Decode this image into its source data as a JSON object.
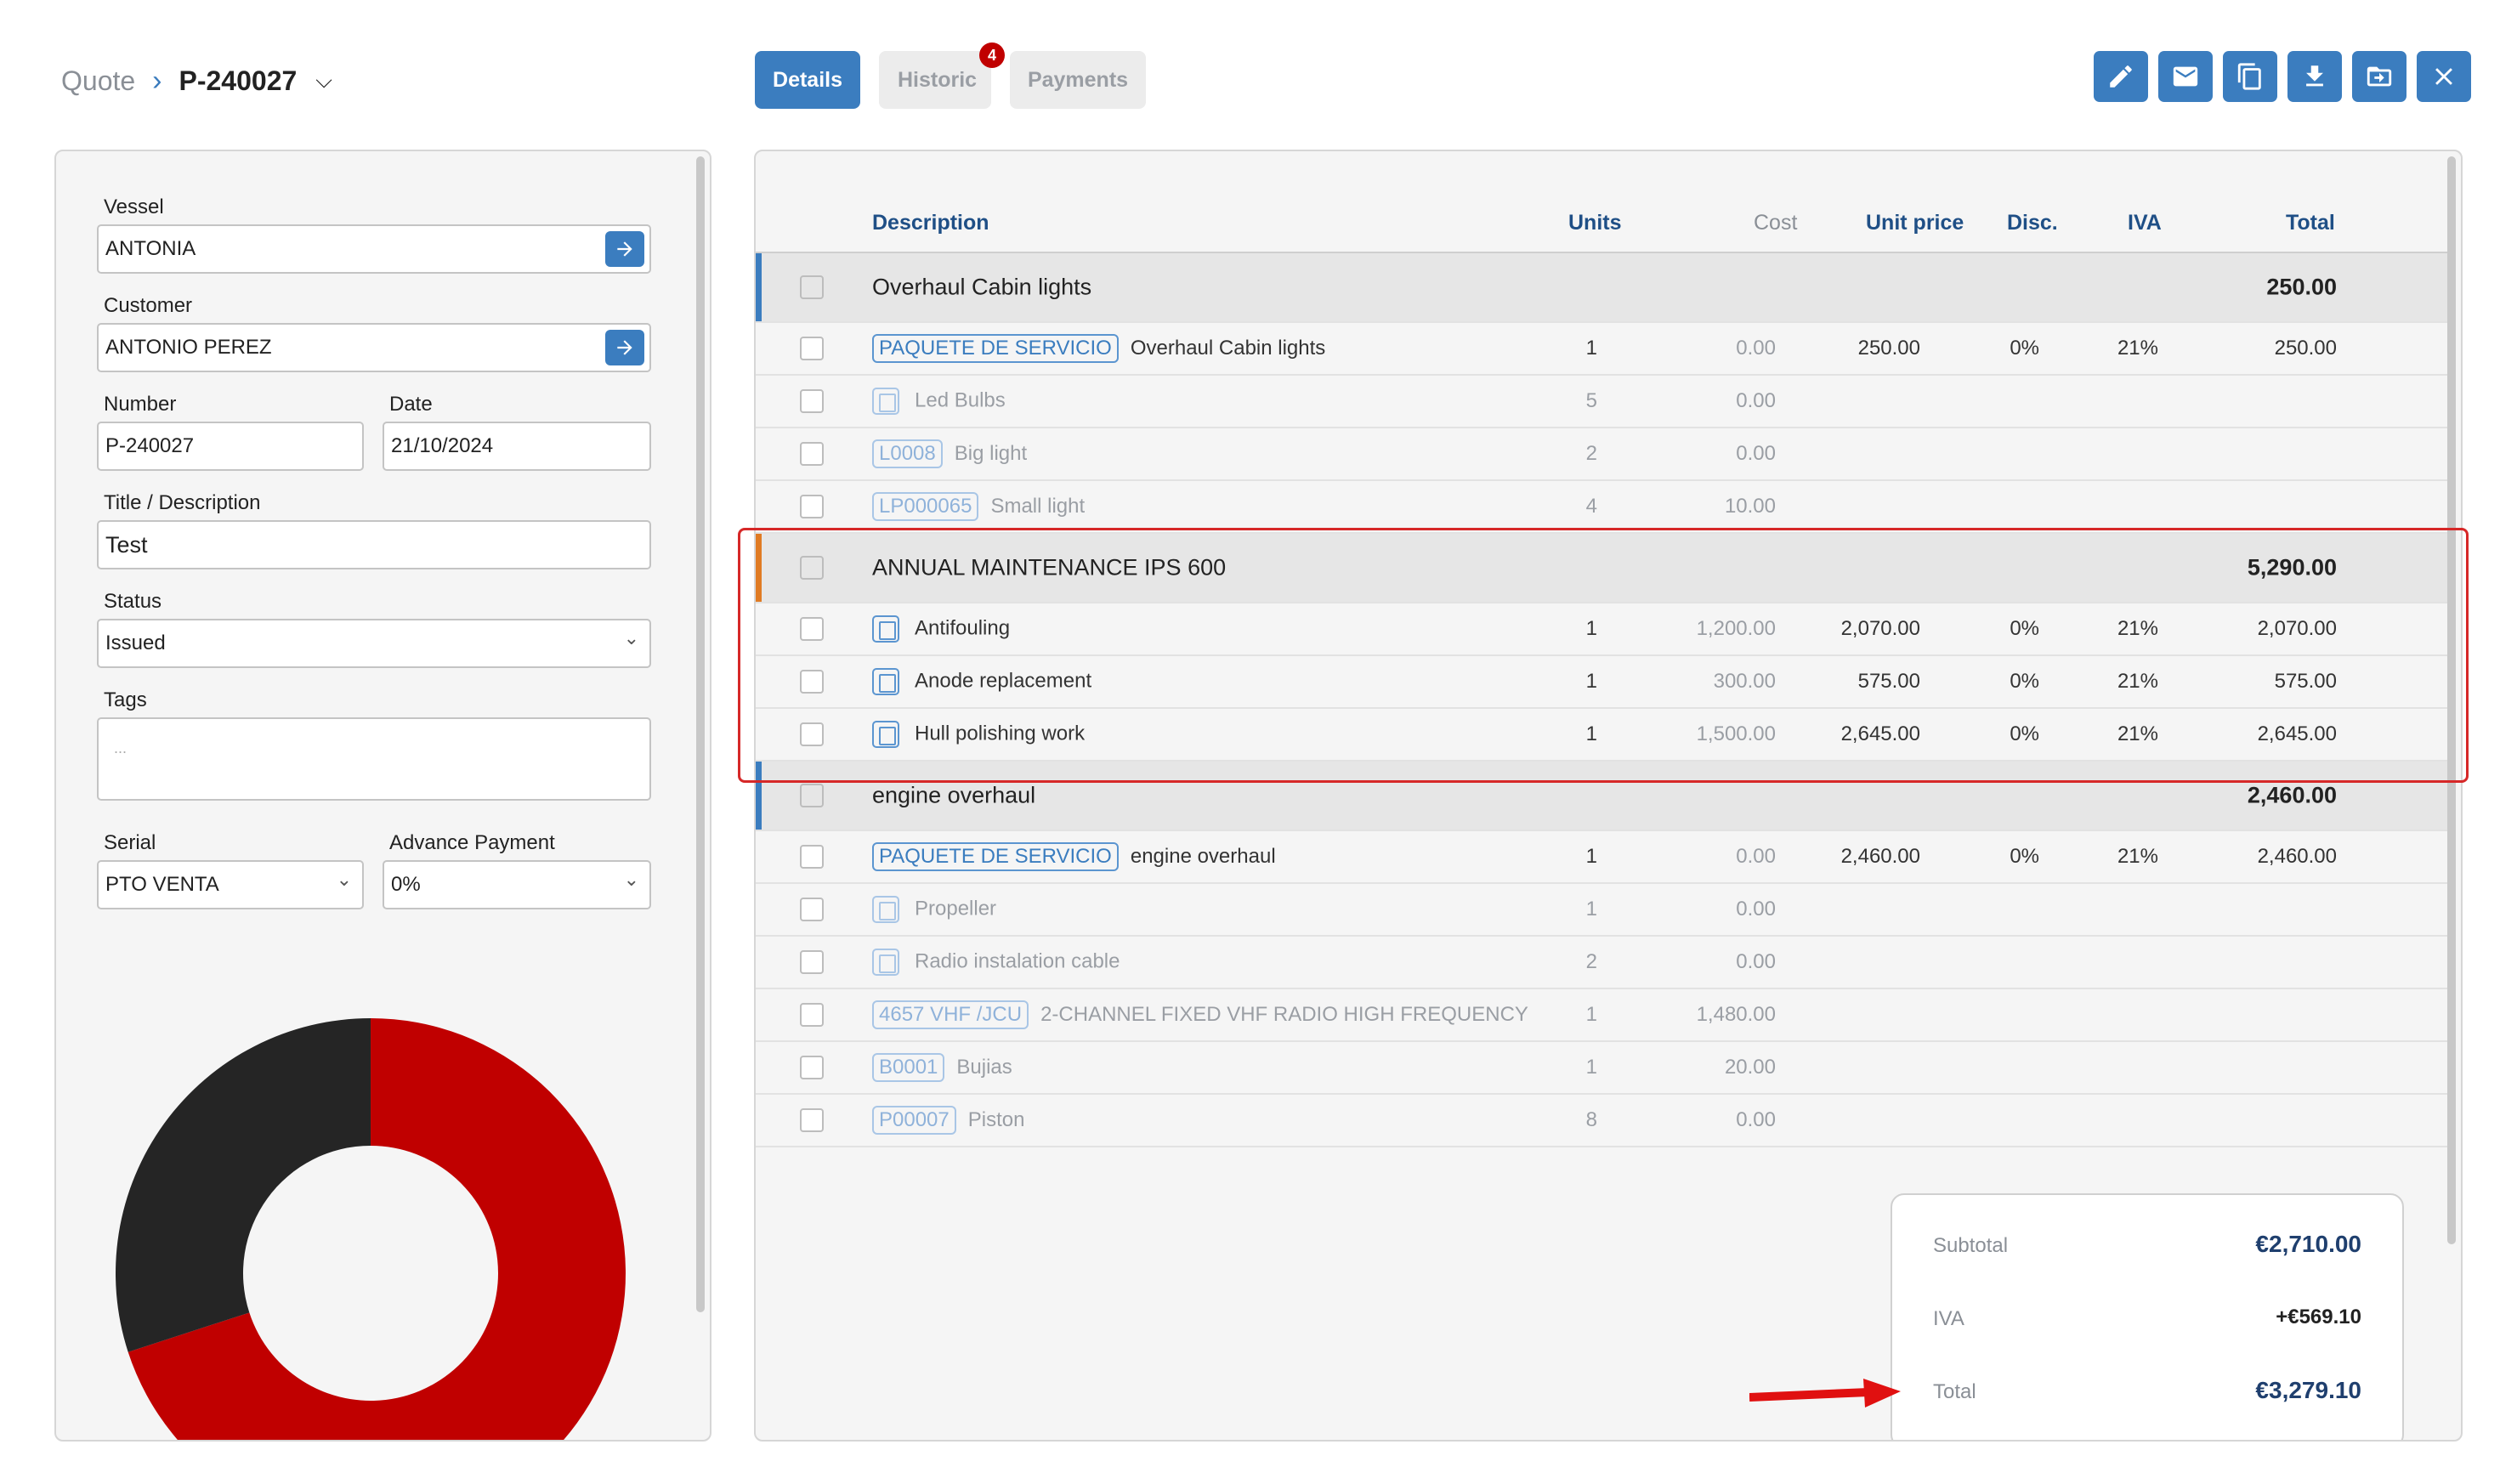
{
  "breadcrumb": {
    "root": "Quote",
    "current": "P-240027"
  },
  "tabs": [
    {
      "label": "Details",
      "active": true
    },
    {
      "label": "Historic",
      "badge": "4"
    },
    {
      "label": "Payments"
    }
  ],
  "toolbar": [
    "edit-icon",
    "mail-icon",
    "copy-icon",
    "download-icon",
    "move-folder-icon",
    "close-icon"
  ],
  "form": {
    "vessel": {
      "label": "Vessel",
      "value": "ANTONIA"
    },
    "customer": {
      "label": "Customer",
      "value": "ANTONIO PEREZ"
    },
    "number": {
      "label": "Number",
      "value": "P-240027"
    },
    "date": {
      "label": "Date",
      "value": "21/10/2024"
    },
    "title": {
      "label": "Title / Description",
      "value": "Test"
    },
    "status": {
      "label": "Status",
      "value": "Issued"
    },
    "tags": {
      "label": "Tags",
      "placeholder": "..."
    },
    "serial": {
      "label": "Serial",
      "value": "PTO VENTA"
    },
    "advance": {
      "label": "Advance Payment",
      "value": "0%"
    }
  },
  "chart_data": {
    "type": "pie",
    "donut": true,
    "slices": [
      {
        "value": 0.7,
        "color": "#c00000"
      },
      {
        "value": 0.3,
        "color": "#252525"
      }
    ]
  },
  "table": {
    "headers": {
      "description": "Description",
      "units": "Units",
      "cost": "Cost",
      "unit_price": "Unit price",
      "disc": "Disc.",
      "iva": "IVA",
      "total": "Total"
    },
    "rows": [
      {
        "kind": "group",
        "bar": "#3b7dbf",
        "desc": "Overhaul Cabin lights",
        "total": "250.00"
      },
      {
        "kind": "item",
        "tag": "PAQUETE DE SERVICIO",
        "desc": "Overhaul Cabin lights",
        "units": "1",
        "cost": "0.00",
        "price": "250.00",
        "disc": "0%",
        "iva": "21%",
        "total": "250.00"
      },
      {
        "kind": "sub",
        "icon": "product-icon",
        "desc": "Led Bulbs",
        "units": "5",
        "cost": "0.00"
      },
      {
        "kind": "sub",
        "tag": "L0008",
        "desc": "Big light",
        "units": "2",
        "cost": "0.00"
      },
      {
        "kind": "sub",
        "tag": "LP000065",
        "desc": "Small light",
        "units": "4",
        "cost": "10.00"
      },
      {
        "kind": "group",
        "bar": "#e07b24",
        "desc": "ANNUAL MAINTENANCE IPS 600",
        "total": "5,290.00"
      },
      {
        "kind": "item",
        "icon": "product-icon",
        "desc": "Antifouling",
        "units": "1",
        "cost": "1,200.00",
        "price": "2,070.00",
        "disc": "0%",
        "iva": "21%",
        "total": "2,070.00"
      },
      {
        "kind": "item",
        "icon": "product-icon",
        "desc": "Anode replacement",
        "units": "1",
        "cost": "300.00",
        "price": "575.00",
        "disc": "0%",
        "iva": "21%",
        "total": "575.00"
      },
      {
        "kind": "item",
        "icon": "product-icon",
        "desc": "Hull polishing work",
        "units": "1",
        "cost": "1,500.00",
        "price": "2,645.00",
        "disc": "0%",
        "iva": "21%",
        "total": "2,645.00"
      },
      {
        "kind": "group",
        "bar": "#3b7dbf",
        "desc": "engine overhaul",
        "total": "2,460.00"
      },
      {
        "kind": "item",
        "tag": "PAQUETE DE SERVICIO",
        "desc": "engine overhaul",
        "units": "1",
        "cost": "0.00",
        "price": "2,460.00",
        "disc": "0%",
        "iva": "21%",
        "total": "2,460.00"
      },
      {
        "kind": "sub",
        "icon": "product-icon",
        "desc": "Propeller",
        "units": "1",
        "cost": "0.00"
      },
      {
        "kind": "sub",
        "icon": "product-icon",
        "desc": "Radio instalation cable",
        "units": "2",
        "cost": "0.00"
      },
      {
        "kind": "sub",
        "tag": "4657 VHF /JCU",
        "desc": "2-CHANNEL FIXED VHF RADIO HIGH FREQUENCY",
        "units": "1",
        "cost": "1,480.00"
      },
      {
        "kind": "sub",
        "tag": "B0001",
        "desc": "Bujias",
        "units": "1",
        "cost": "20.00"
      },
      {
        "kind": "sub",
        "tag": "P00007",
        "desc": "Piston",
        "units": "8",
        "cost": "0.00"
      }
    ]
  },
  "summary": {
    "subtotal_label": "Subtotal",
    "subtotal": "€2,710.00",
    "iva_label": "IVA",
    "iva": "+€569.10",
    "total_label": "Total",
    "total": "€3,279.10"
  }
}
